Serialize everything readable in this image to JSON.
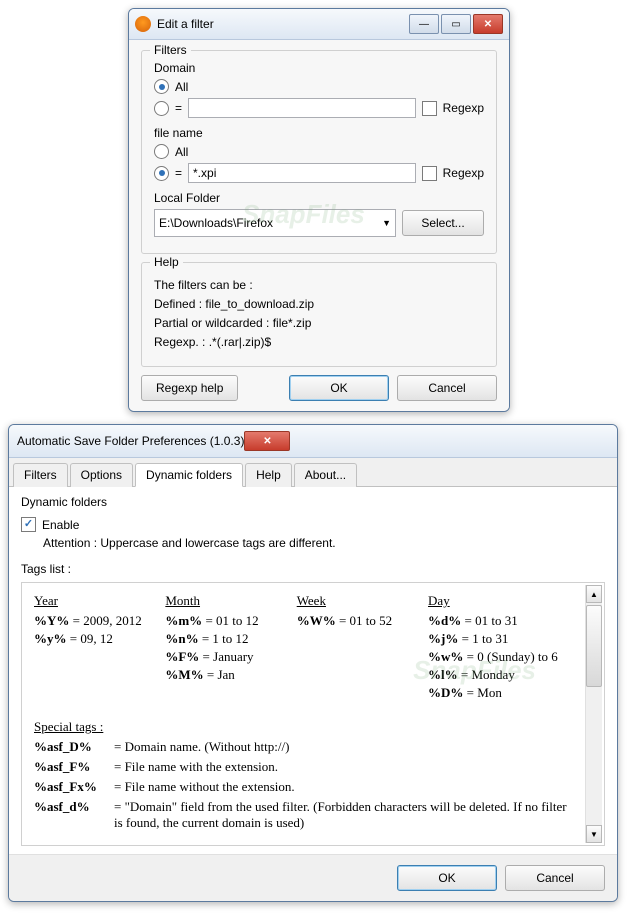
{
  "window1": {
    "title": "Edit a filter",
    "filters_legend": "Filters",
    "domain_label": "Domain",
    "all_label": "All",
    "eq_label": "=",
    "regexp_label": "Regexp",
    "domain_value": "",
    "domain_radio": "all",
    "domain_regexp_checked": false,
    "filename_label": "file name",
    "filename_value": "*.xpi",
    "filename_radio": "eq",
    "filename_regexp_checked": false,
    "local_folder_label": "Local Folder",
    "local_folder_value": "E:\\Downloads\\Firefox",
    "select_button": "Select...",
    "help_legend": "Help",
    "help_lines": [
      "The filters can be :",
      "Defined : file_to_download.zip",
      "Partial or wildcarded : file*.zip",
      "Regexp. : .*(.rar|.zip)$"
    ],
    "regexp_help_button": "Regexp help",
    "ok_button": "OK",
    "cancel_button": "Cancel",
    "watermark": "SnapFiles"
  },
  "window2": {
    "title": "Automatic Save Folder Preferences (1.0.3)",
    "tabs": [
      "Filters",
      "Options",
      "Dynamic folders",
      "Help",
      "About..."
    ],
    "active_tab": 2,
    "panel_title": "Dynamic folders",
    "enable_label": "Enable",
    "enable_checked": true,
    "attention_text": "Attention : Uppercase and lowercase tags are different.",
    "tags_list_label": "Tags list :",
    "watermark": "SnapFiles",
    "columns": {
      "year": {
        "head": "Year",
        "lines": [
          {
            "tag": "%Y%",
            "eq": " = 2009, 2012"
          },
          {
            "tag": "%y%",
            "eq": " = 09, 12"
          }
        ]
      },
      "month": {
        "head": "Month",
        "lines": [
          {
            "tag": "%m%",
            "eq": " = 01 to 12"
          },
          {
            "tag": "%n%",
            "eq": " = 1 to 12"
          },
          {
            "tag": "%F%",
            "eq": " = January"
          },
          {
            "tag": "%M%",
            "eq": " = Jan"
          }
        ]
      },
      "week": {
        "head": "Week",
        "lines": [
          {
            "tag": "%W%",
            "eq": " = 01 to 52"
          }
        ]
      },
      "day": {
        "head": "Day",
        "lines": [
          {
            "tag": "%d%",
            "eq": " = 01 to 31"
          },
          {
            "tag": "%j%",
            "eq": " = 1 to 31"
          },
          {
            "tag": "%w%",
            "eq": " = 0 (Sunday) to 6"
          },
          {
            "tag": "%l%",
            "eq": " = Monday"
          },
          {
            "tag": "%D%",
            "eq": " = Mon"
          }
        ]
      }
    },
    "special_head": "Special tags :",
    "special": [
      {
        "tag": "%asf_D%",
        "desc": "= Domain name. (Without http://)"
      },
      {
        "tag": "%asf_F%",
        "desc": "= File name with the extension."
      },
      {
        "tag": "%asf_Fx%",
        "desc": "= File name without the extension."
      },
      {
        "tag": "%asf_d%",
        "desc": "= \"Domain\" field from the used filter. (Forbidden characters will be deleted. If no filter is found, the current domain is used)"
      }
    ],
    "ok_button": "OK",
    "cancel_button": "Cancel"
  }
}
